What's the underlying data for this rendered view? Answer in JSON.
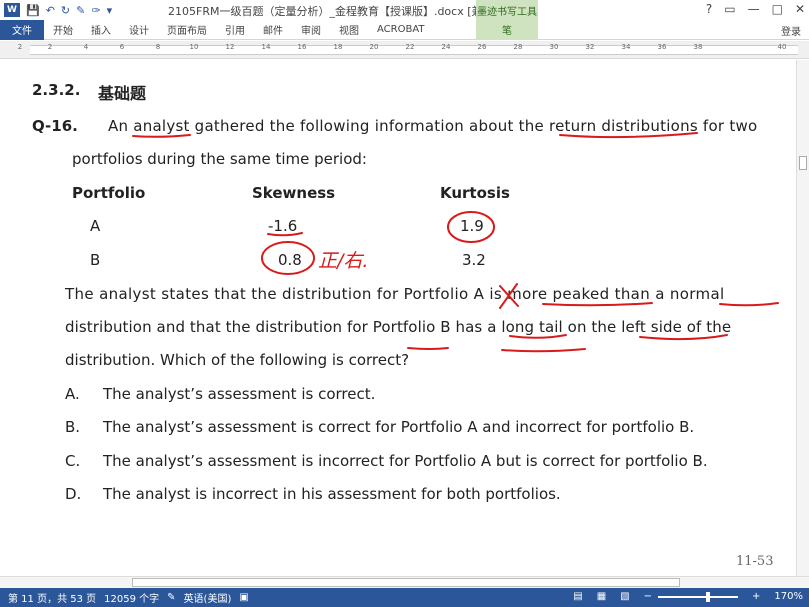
{
  "titlebar": {
    "word_icon": "W",
    "doc_title": "2105FRM一级百题（定量分析）_金程教育【授课版】.docx [兼容模...",
    "context_tab": "墨迹书写工具",
    "help": "?",
    "restore": "▭",
    "minimize": "—",
    "maximize": "□",
    "close": "✕"
  },
  "ribbon": {
    "tabs": [
      "文件",
      "开始",
      "插入",
      "设计",
      "页面布局",
      "引用",
      "邮件",
      "审阅",
      "视图",
      "ACROBAT"
    ],
    "pen_tab": "笔",
    "login": "登录"
  },
  "ruler": {
    "ticks": [
      "2",
      "2",
      "4",
      "6",
      "8",
      "10",
      "12",
      "14",
      "16",
      "18",
      "20",
      "22",
      "24",
      "26",
      "28",
      "30",
      "32",
      "34",
      "36",
      "38",
      "40"
    ]
  },
  "doc": {
    "heading_num": "2.3.2.",
    "heading_title": "基础题",
    "q_num": "Q-16.",
    "q_line1": "An analyst gathered the following information about the return distributions for two",
    "q_line2": "portfolios during the same time period:",
    "table": {
      "headers": [
        "Portfolio",
        "Skewness",
        "Kurtosis"
      ],
      "rows": [
        [
          "A",
          "-1.6",
          "1.9"
        ],
        [
          "B",
          "0.8",
          "3.2"
        ]
      ]
    },
    "para_line1": "The analyst states that the distribution for Portfolio A is more peaked than a normal",
    "para_line2": "distribution and that the distribution for Portfolio B has a long tail on the left side of the",
    "para_line3": "distribution. Which of the following is correct?",
    "options": [
      {
        "letter": "A.",
        "text": "The analyst’s assessment is correct."
      },
      {
        "letter": "B.",
        "text": "The analyst’s assessment is correct for Portfolio A and incorrect for portfolio B."
      },
      {
        "letter": "C.",
        "text": "The analyst’s assessment is incorrect for Portfolio A but is correct for portfolio B."
      },
      {
        "letter": "D.",
        "text": "The analyst is incorrect in his assessment for both portfolios."
      }
    ],
    "page_number": "11-53"
  },
  "status": {
    "page": "第 11 页，共 53 页",
    "words": "12059 个字",
    "lang": "英语(美国)",
    "zoom": "170%",
    "zoom_minus": "−",
    "zoom_plus": "+"
  },
  "colors": {
    "word_blue": "#2b579a",
    "ink_red": "#d91a1a",
    "context_green": "#cfe3c0"
  }
}
